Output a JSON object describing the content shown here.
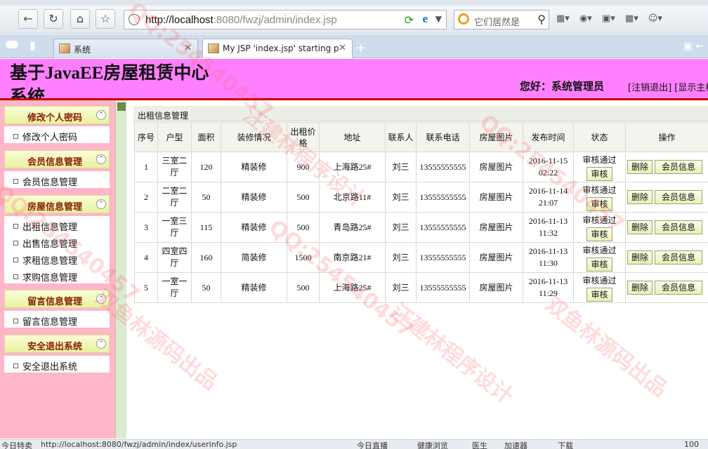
{
  "browser": {
    "address_url_host": "http://localhost",
    "address_url_rest": ":8080/fwzj/admin/index.jsp",
    "search_placeholder": "它们居然是",
    "tabs": [
      {
        "label": "系统"
      },
      {
        "label": "My JSP 'index.jsp' starting p"
      }
    ],
    "status_bar": {
      "left": "今日特卖",
      "url": "http://localhost:8080/fwzj/admin/index/userinfo.jsp",
      "items": [
        "今日直播",
        "健康浏览",
        "医生",
        "加速器",
        "下载"
      ],
      "zoom": "100"
    }
  },
  "header": {
    "title": "基于JavaEE房屋租赁中心系统",
    "welcome": "您好：系统管理员",
    "links": "[注销退出] [显示主框"
  },
  "sidebar": {
    "groups": [
      {
        "title": "修改个人密码",
        "items": [
          "修改个人密码"
        ]
      },
      {
        "title": "会员信息管理",
        "items": [
          "会员信息管理"
        ]
      },
      {
        "title": "房屋信息管理",
        "items": [
          "出租信息管理",
          "出售信息管理",
          "求租信息管理",
          "求购信息管理"
        ]
      },
      {
        "title": "留言信息管理",
        "items": [
          "留言信息管理"
        ]
      },
      {
        "title": "安全退出系统",
        "items": [
          "安全退出系统"
        ]
      }
    ]
  },
  "main": {
    "breadcrumb": "出租信息管理",
    "table": {
      "headers": [
        "序号",
        "户型",
        "面积",
        "装修情况",
        "出租价格",
        "地址",
        "联系人",
        "联系电话",
        "房屋图片",
        "发布时间",
        "状态",
        "操作"
      ],
      "rows": [
        {
          "no": "1",
          "type": "三室二厅",
          "area": "120",
          "decoration": "精装修",
          "price": "900",
          "address": "上海路25#",
          "contact": "刘三",
          "phone": "13555555555",
          "image": "房屋图片",
          "time": "2016-11-15 02:22",
          "status": "审核通过"
        },
        {
          "no": "2",
          "type": "二室二厅",
          "area": "50",
          "decoration": "精装修",
          "price": "500",
          "address": "北京路11#",
          "contact": "刘三",
          "phone": "13555555555",
          "image": "房屋图片",
          "time": "2016-11-14 21:07",
          "status": "审核通过"
        },
        {
          "no": "3",
          "type": "一室三厅",
          "area": "115",
          "decoration": "精装修",
          "price": "500",
          "address": "青岛路25#",
          "contact": "刘三",
          "phone": "13555555555",
          "image": "房屋图片",
          "time": "2016-11-13 11:32",
          "status": "审核通过"
        },
        {
          "no": "4",
          "type": "四室四厅",
          "area": "160",
          "decoration": "简装修",
          "price": "1500",
          "address": "南京路21#",
          "contact": "刘三",
          "phone": "13555555555",
          "image": "房屋图片",
          "time": "2016-11-13 11:30",
          "status": "审核通过"
        },
        {
          "no": "5",
          "type": "一室一厅",
          "area": "50",
          "decoration": "精装修",
          "price": "500",
          "address": "上海路25#",
          "contact": "刘三",
          "phone": "13555555555",
          "image": "房屋图片",
          "time": "2016-11-13 11:29",
          "status": "审核通过"
        }
      ],
      "button_labels": {
        "audit": "审核",
        "delete": "删除",
        "member_info": "会员信息"
      }
    }
  },
  "watermarks": [
    "QQ:254540457",
    "汪建林程序设计",
    "双鱼林源码出品"
  ]
}
